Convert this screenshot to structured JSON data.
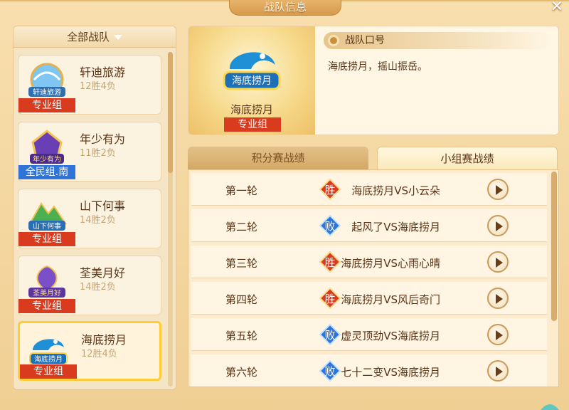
{
  "window": {
    "title": "战队信息"
  },
  "filter": {
    "label": "全部战队"
  },
  "teams": [
    {
      "name": "轩迪旅游",
      "record": "12胜4负",
      "group": "专业组",
      "emblem_text": "轩迪旅游"
    },
    {
      "name": "年少有为",
      "record": "11胜2负",
      "group": "全民组.南",
      "emblem_text": "年少有为"
    },
    {
      "name": "山下何事",
      "record": "14胜2负",
      "group": "专业组",
      "emblem_text": "山下何事"
    },
    {
      "name": "荃美月好",
      "record": "14胜2负",
      "group": "专业组",
      "emblem_text": "荃美月好"
    },
    {
      "name": "海底捞月",
      "record": "12胜4负",
      "group": "专业组",
      "emblem_text": "海底捞月"
    }
  ],
  "selected_team": {
    "name": "海底捞月",
    "group": "专业组",
    "emblem_text": "海底捞月",
    "slogan_title": "战队口号",
    "slogan": "海底捞月，摇山振岳。"
  },
  "tabs": [
    {
      "label": "积分赛战绩",
      "active": false
    },
    {
      "label": "小组赛战绩",
      "active": true
    }
  ],
  "matches": [
    {
      "round": "第一轮",
      "result": "胜",
      "text": "海底捞月VS小云朵"
    },
    {
      "round": "第二轮",
      "result": "败",
      "text": "起风了VS海底捞月"
    },
    {
      "round": "第三轮",
      "result": "胜",
      "text": "海底捞月VS心雨心晴"
    },
    {
      "round": "第四轮",
      "result": "胜",
      "text": "海底捞月VS风后奇门"
    },
    {
      "round": "第五轮",
      "result": "败",
      "text": "虚灵顶劲VS海底捞月"
    },
    {
      "round": "第六轮",
      "result": "败",
      "text": "七十二变VS海底捞月"
    }
  ],
  "colors": {
    "win": "#d93b1f",
    "loss": "#2f74d8",
    "pro_tag": "#d93b1f",
    "public_tag": "#2f74d8",
    "selected_border": "#ffcc33"
  }
}
